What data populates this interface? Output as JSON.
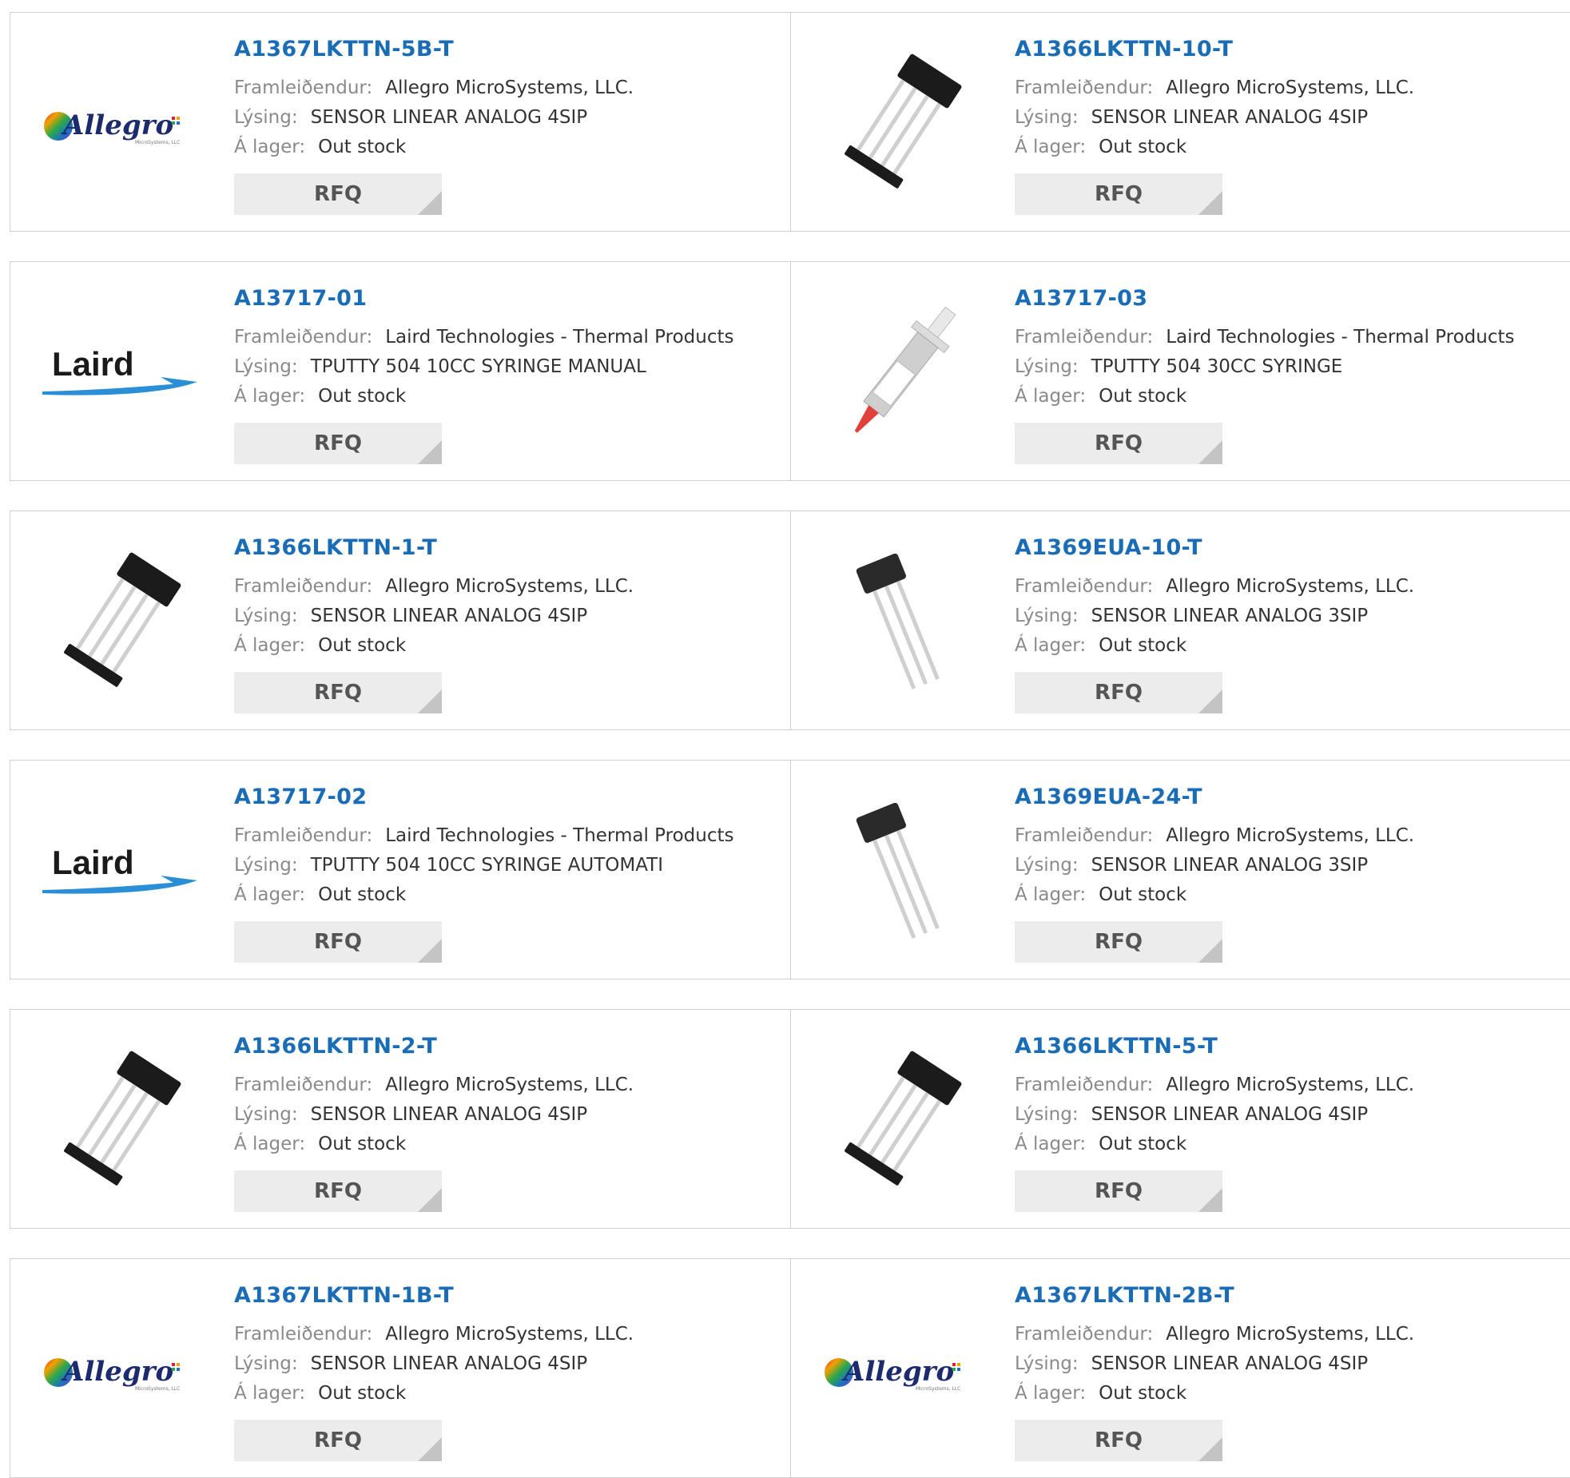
{
  "labels": {
    "manufacturer": "Framleiðendur:",
    "description": "Lýsing:",
    "stock": "Á lager:",
    "rfq": "RFQ"
  },
  "logos": {
    "allegro": "Allegro",
    "allegro_sub": "MicroSystems, LLC",
    "laird": "Laird"
  },
  "products": [
    {
      "part": "A1367LKTTN-5B-T",
      "manufacturer": "Allegro MicroSystems, LLC.",
      "description": "SENSOR LINEAR ANALOG 4SIP",
      "stock": "Out stock",
      "image": "allegro-logo"
    },
    {
      "part": "A1366LKTTN-10-T",
      "manufacturer": "Allegro MicroSystems, LLC.",
      "description": "SENSOR LINEAR ANALOG 4SIP",
      "stock": "Out stock",
      "image": "sip4-chip"
    },
    {
      "part": "A13717-01",
      "manufacturer": "Laird Technologies - Thermal Products",
      "description": "TPUTTY 504 10CC SYRINGE MANUAL",
      "stock": "Out stock",
      "image": "laird-logo"
    },
    {
      "part": "A13717-03",
      "manufacturer": "Laird Technologies - Thermal Products",
      "description": "TPUTTY 504 30CC SYRINGE",
      "stock": "Out stock",
      "image": "syringe"
    },
    {
      "part": "A1366LKTTN-1-T",
      "manufacturer": "Allegro MicroSystems, LLC.",
      "description": "SENSOR LINEAR ANALOG 4SIP",
      "stock": "Out stock",
      "image": "sip4-chip"
    },
    {
      "part": "A1369EUA-10-T",
      "manufacturer": "Allegro MicroSystems, LLC.",
      "description": "SENSOR LINEAR ANALOG 3SIP",
      "stock": "Out stock",
      "image": "sip3-chip"
    },
    {
      "part": "A13717-02",
      "manufacturer": "Laird Technologies - Thermal Products",
      "description": "TPUTTY 504 10CC SYRINGE AUTOMATI",
      "stock": "Out stock",
      "image": "laird-logo"
    },
    {
      "part": "A1369EUA-24-T",
      "manufacturer": "Allegro MicroSystems, LLC.",
      "description": "SENSOR LINEAR ANALOG 3SIP",
      "stock": "Out stock",
      "image": "sip3-chip"
    },
    {
      "part": "A1366LKTTN-2-T",
      "manufacturer": "Allegro MicroSystems, LLC.",
      "description": "SENSOR LINEAR ANALOG 4SIP",
      "stock": "Out stock",
      "image": "sip4-chip"
    },
    {
      "part": "A1366LKTTN-5-T",
      "manufacturer": "Allegro MicroSystems, LLC.",
      "description": "SENSOR LINEAR ANALOG 4SIP",
      "stock": "Out stock",
      "image": "sip4-chip"
    },
    {
      "part": "A1367LKTTN-1B-T",
      "manufacturer": "Allegro MicroSystems, LLC.",
      "description": "SENSOR LINEAR ANALOG 4SIP",
      "stock": "Out stock",
      "image": "allegro-logo"
    },
    {
      "part": "A1367LKTTN-2B-T",
      "manufacturer": "Allegro MicroSystems, LLC.",
      "description": "SENSOR LINEAR ANALOG 4SIP",
      "stock": "Out stock",
      "image": "allegro-logo"
    }
  ]
}
